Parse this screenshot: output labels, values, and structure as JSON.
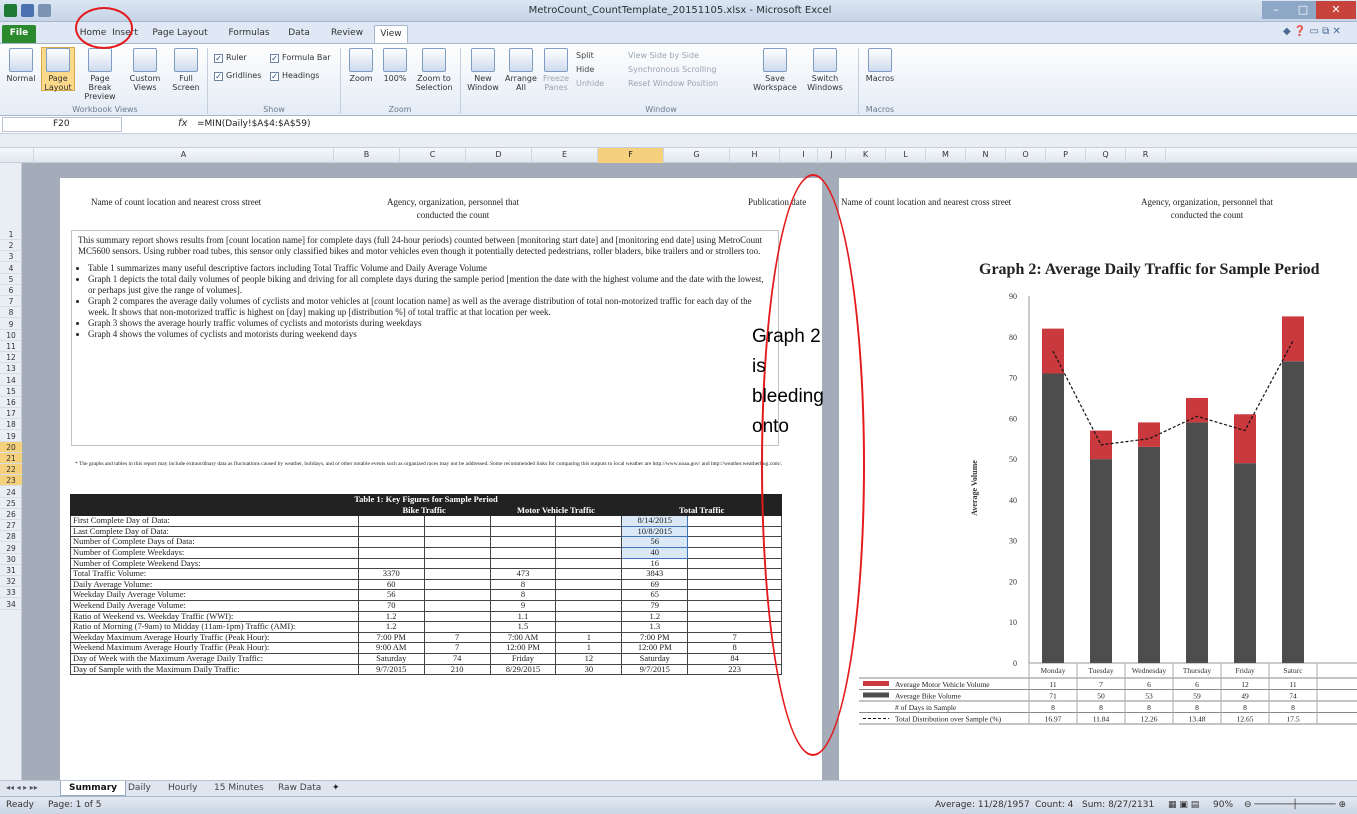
{
  "window": {
    "title": "MetroCount_CountTemplate_20151105.xlsx - Microsoft Excel"
  },
  "tabs": [
    "File",
    "Home",
    "Insert",
    "Page Layout",
    "Formulas",
    "Data",
    "Review",
    "View"
  ],
  "ribbon": {
    "workbook_views": {
      "label": "Workbook Views",
      "buttons": [
        "Normal",
        "Page Layout",
        "Page Break Preview",
        "Custom Views",
        "Full Screen"
      ]
    },
    "show": {
      "label": "Show",
      "ruler": "Ruler",
      "formula_bar": "Formula Bar",
      "gridlines": "Gridlines",
      "headings": "Headings"
    },
    "zoom": {
      "label": "Zoom",
      "buttons": [
        "Zoom",
        "100%",
        "Zoom to Selection"
      ]
    },
    "window": {
      "label": "Window",
      "buttons": [
        "New Window",
        "Arrange All",
        "Freeze Panes"
      ],
      "small": [
        "Split",
        "Hide",
        "Unhide"
      ],
      "small2": [
        "View Side by Side",
        "Synchronous Scrolling",
        "Reset Window Position"
      ],
      "save_ws": "Save Workspace",
      "switch": "Switch Windows"
    },
    "macros": {
      "label": "Macros",
      "button": "Macros"
    }
  },
  "formula_bar": {
    "name_box": "F20",
    "fx": "fx",
    "formula": "=MIN(Daily!$A$4:$A$59)"
  },
  "columns": [
    "A",
    "B",
    "C",
    "D",
    "E",
    "F",
    "G",
    "H",
    "I",
    "J",
    "K",
    "L",
    "M",
    "N",
    "O",
    "P",
    "Q",
    "R"
  ],
  "rows": [
    "1",
    "2",
    "3",
    "4",
    "5",
    "6",
    "7",
    "8",
    "9",
    "10",
    "11",
    "12",
    "13",
    "14",
    "15",
    "16",
    "17",
    "18",
    "19",
    "20",
    "21",
    "22",
    "23",
    "24",
    "25",
    "26",
    "27",
    "28",
    "29",
    "30",
    "31",
    "32",
    "33",
    "34"
  ],
  "page1": {
    "hdr_left": "Name of count location and nearest cross street",
    "hdr_mid1": "Agency, organization, personnel that",
    "hdr_mid2": "conducted the count",
    "hdr_right": "Publication date",
    "summary": "This summary report shows results from [count location name] for complete days (full 24-hour periods) counted between [monitoring start date] and [monitoring end date] using MetroCount MC5600 sensors. Using rubber road tubes, this sensor only classified bikes and motor vehicles even though it potentially detected pedestrians, roller bladers, bike trailers and or strollers too.",
    "bullets": [
      "Table 1 summarizes many useful descriptive factors including Total Traffic Volume and Daily Average Volume",
      "Graph 1 depicts the total daily volumes of people biking and driving for all complete days during the sample period [mention the date with the highest volume and the date with the lowest, or perhaps just give the range of volumes].",
      "Graph 2 compares the average daily volumes of cyclists and motor vehicles at [count location name] as well as the average distribution of total non-motorized traffic for each day of the week. It shows that non-motorized traffic is highest on [day] making up [distribution %] of total traffic at that location per week.",
      "Graph 3 shows the average hourly traffic volumes of cyclists and motorists during weekdays",
      "Graph 4 shows the volumes of cyclists and motorists during weekend days"
    ],
    "footnote": "* The graphs and tables in this report may include extraordinary data as fluctuations caused by weather, holidays, and or other notable events such as organized races may not be addressed. Some recommended links for comparing this outputs to local weather are http://www.noaa.gov/ and http://weather.weatherbug.com/.",
    "table": {
      "title": "Table 1: Key Figures for Sample Period",
      "col_heads": [
        "Bike Traffic",
        "Motor Vehicle Traffic",
        "Total Traffic"
      ],
      "rows": [
        [
          "First Complete Day of Data:",
          "",
          "",
          "",
          "",
          "8/14/2015",
          ""
        ],
        [
          "Last Complete Day of Data:",
          "",
          "",
          "",
          "",
          "10/8/2015",
          ""
        ],
        [
          "Number of Complete Days of Data:",
          "",
          "",
          "",
          "",
          "56",
          ""
        ],
        [
          "Number of Complete Weekdays:",
          "",
          "",
          "",
          "",
          "40",
          ""
        ],
        [
          "Number of Complete Weekend Days:",
          "",
          "",
          "",
          "",
          "16",
          ""
        ],
        [
          "Total Traffic Volume:",
          "3370",
          "",
          "473",
          "",
          "3843",
          ""
        ],
        [
          "Daily Average Volume:",
          "60",
          "",
          "8",
          "",
          "69",
          ""
        ],
        [
          "Weekday Daily Average Volume:",
          "56",
          "",
          "8",
          "",
          "65",
          ""
        ],
        [
          "Weekend Daily Average Volume:",
          "70",
          "",
          "9",
          "",
          "79",
          ""
        ],
        [
          "Ratio of Weekend vs. Weekday Traffic (WWI):",
          "1.2",
          "",
          "1.1",
          "",
          "1.2",
          ""
        ],
        [
          "Ratio of Morning (7-9am) to Midday (11am-1pm) Traffic (AMI):",
          "1.2",
          "",
          "1.5",
          "",
          "1.3",
          ""
        ],
        [
          "Weekday Maximum Average Hourly Traffic (Peak Hour):",
          "7:00 PM",
          "7",
          "7:00 AM",
          "1",
          "7:00 PM",
          "7"
        ],
        [
          "Weekend Maximum Average Hourly Traffic (Peak Hour):",
          "9:00 AM",
          "7",
          "12:00 PM",
          "1",
          "12:00 PM",
          "8"
        ],
        [
          "Day of Week with the Maximum Average Daily Traffic:",
          "Saturday",
          "74",
          "Friday",
          "12",
          "Saturday",
          "84"
        ],
        [
          "Day of Sample with the Maximum Daily Traffic:",
          "9/7/2015",
          "210",
          "8/29/2015",
          "30",
          "9/7/2015",
          "223"
        ]
      ]
    }
  },
  "page2": {
    "hdr_left": "Name of count location and nearest cross street",
    "hdr_mid1": "Agency, organization, personnel that",
    "hdr_mid2": "conducted the count"
  },
  "chart_data": {
    "type": "bar",
    "title": "Graph 2: Average Daily Traffic for Sample Period",
    "ylabel": "Average Volume",
    "ylim": [
      0,
      90
    ],
    "yticks": [
      0,
      10,
      20,
      30,
      40,
      50,
      60,
      70,
      80,
      90
    ],
    "categories": [
      "Monday",
      "Tuesday",
      "Wednesday",
      "Thursday",
      "Friday",
      "Saturday"
    ],
    "category_labels": [
      "Monday",
      "Tuesday",
      "Wednesday",
      "Thursday",
      "Friday",
      "Saturc"
    ],
    "series": [
      {
        "name": "Average Motor Vehicle Volume",
        "values": [
          11,
          7,
          6,
          6,
          12,
          11
        ],
        "color": "#c9393e"
      },
      {
        "name": "Average Bike Volume",
        "values": [
          71,
          50,
          53,
          59,
          49,
          74
        ],
        "color": "#4d4d4d"
      },
      {
        "name": "# of Days in Sample",
        "values": [
          8,
          8,
          8,
          8,
          8,
          8
        ]
      },
      {
        "name": "Total Distribution over Sample (%)",
        "values": [
          16.97,
          11.84,
          12.26,
          13.48,
          12.65,
          17.5
        ],
        "line_values_volume": [
          76.5,
          53.5,
          55,
          60.5,
          57,
          79
        ]
      }
    ],
    "table_values": [
      [
        "11",
        "7",
        "6",
        "6",
        "12",
        "11"
      ],
      [
        "71",
        "50",
        "53",
        "59",
        "49",
        "74"
      ],
      [
        "8",
        "8",
        "8",
        "8",
        "8",
        "8"
      ],
      [
        "16.97",
        "11.84",
        "12.26",
        "13.48",
        "12.65",
        "17.5"
      ]
    ]
  },
  "annotation": {
    "text_lines": [
      "Graph 2",
      "is",
      "bleeding",
      "onto"
    ],
    "color": "#e41a1c"
  },
  "sheet_tabs": [
    "Summary",
    "Daily",
    "Hourly",
    "15 Minutes",
    "Raw Data"
  ],
  "status": {
    "ready": "Ready",
    "page": "Page: 1 of 5",
    "average": "Average: 11/28/1957",
    "count": "Count: 4",
    "sum": "Sum: 8/27/2131",
    "zoom": "90%"
  }
}
